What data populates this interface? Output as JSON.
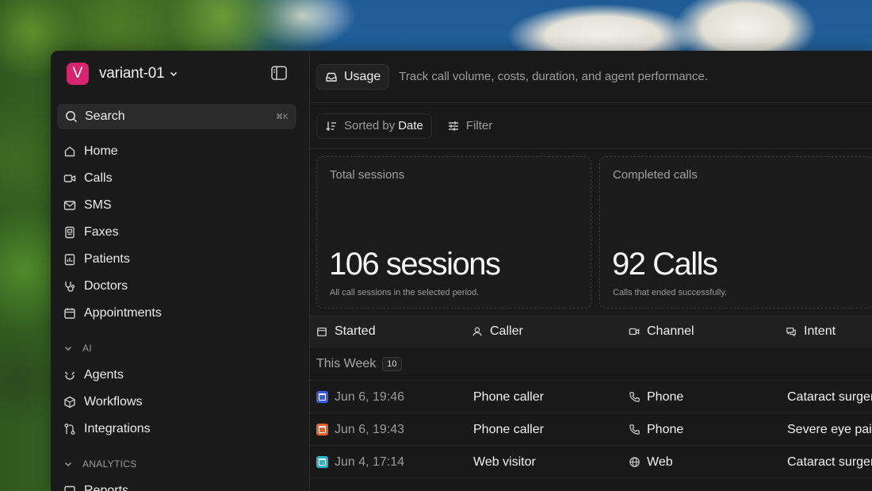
{
  "workspace": {
    "initial": "V",
    "name": "variant-01",
    "logo_color": "#d6246e"
  },
  "search": {
    "label": "Search",
    "shortcut": "⌘K"
  },
  "nav": [
    {
      "label": "Home",
      "icon": "home-icon"
    },
    {
      "label": "Calls",
      "icon": "video-icon"
    },
    {
      "label": "SMS",
      "icon": "mail-icon"
    },
    {
      "label": "Faxes",
      "icon": "fax-icon"
    },
    {
      "label": "Patients",
      "icon": "clipboard-icon"
    },
    {
      "label": "Doctors",
      "icon": "stethoscope-icon"
    },
    {
      "label": "Appointments",
      "icon": "calendar-icon"
    }
  ],
  "ai_section": {
    "title": "AI",
    "items": [
      {
        "label": "Agents",
        "icon": "agent-icon"
      },
      {
        "label": "Workflows",
        "icon": "cube-icon"
      },
      {
        "label": "Integrations",
        "icon": "integration-icon"
      }
    ]
  },
  "analytics_section": {
    "title": "ANALYTICS",
    "items": [
      {
        "label": "Reports"
      }
    ]
  },
  "header": {
    "tab_label": "Usage",
    "description": "Track call volume, costs, duration, and agent performance."
  },
  "toolbar": {
    "sorted_prefix": "Sorted by",
    "sorted_value": "Date",
    "filter_label": "Filter"
  },
  "cards": [
    {
      "title": "Total sessions",
      "value": "106 sessions",
      "subtitle": "All call sessions in the selected period."
    },
    {
      "title": "Completed calls",
      "value": "92 Calls",
      "subtitle": "Calls that ended successfully."
    }
  ],
  "table": {
    "columns": [
      "Started",
      "Caller",
      "Channel",
      "Intent"
    ],
    "group": {
      "label": "This Week",
      "count": "10"
    },
    "rows": [
      {
        "started": "Jun 6, 19:46",
        "caller": "Phone caller",
        "channel": "Phone",
        "intent": "Cataract surgery",
        "color": "#3b5bd9"
      },
      {
        "started": "Jun 6, 19:43",
        "caller": "Phone caller",
        "channel": "Phone",
        "intent": "Severe eye pain",
        "color": "#e3622d"
      },
      {
        "started": "Jun 4, 17:14",
        "caller": "Web visitor",
        "channel": "Web",
        "intent": "Cataract surgery",
        "color": "#2bb3c7"
      }
    ]
  },
  "colors": {
    "accent": "#d6246e",
    "panel": "#1a1919"
  }
}
